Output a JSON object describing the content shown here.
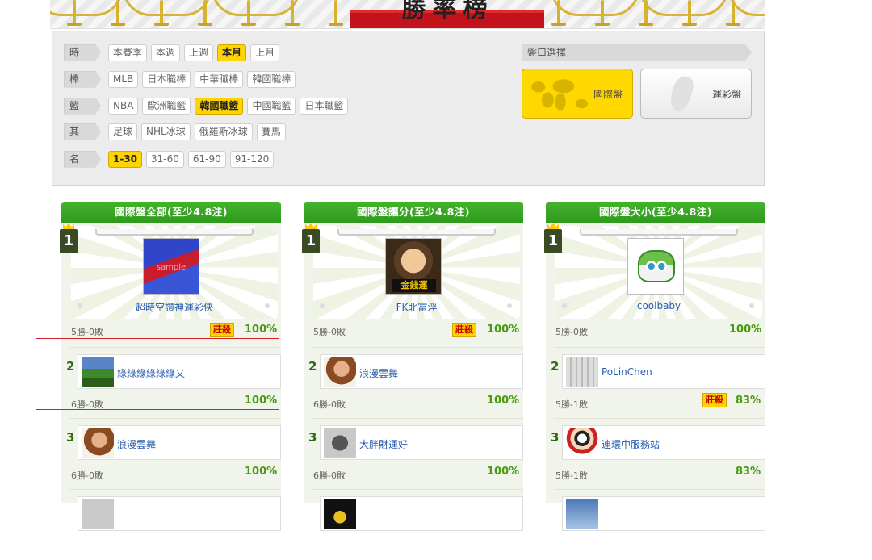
{
  "banner": {
    "title": "勝率榜"
  },
  "filters": [
    {
      "label": "時間",
      "options": [
        "本賽季",
        "本週",
        "上週",
        "本月",
        "上月"
      ],
      "active": 3
    },
    {
      "label": "棒球",
      "options": [
        "MLB",
        "日本職棒",
        "中華職棒",
        "韓國職棒"
      ],
      "active": -1
    },
    {
      "label": "籃球",
      "options": [
        "NBA",
        "歐洲職籃",
        "韓國職籃",
        "中國職籃",
        "日本職籃"
      ],
      "active": 2
    },
    {
      "label": "其他",
      "options": [
        "足球",
        "NHL冰球",
        "俄羅斯冰球",
        "賽馬"
      ],
      "active": -1
    },
    {
      "label": "名次",
      "options": [
        "1-30",
        "31-60",
        "61-90",
        "91-120"
      ],
      "active": 0
    }
  ],
  "pankou": {
    "label": "盤口選擇",
    "intl": "國際盤",
    "tw": "運彩盤"
  },
  "panels": [
    {
      "title": "國際盤全部(至少4.8注)",
      "top": {
        "name": "超時空讚神運彩俠",
        "record": "5勝-0敗",
        "tag": "莊殺",
        "pct": "100%",
        "avatar_text": "sample"
      },
      "rows": [
        {
          "rank": "2",
          "name": "綠綠綠綠綠綠乂",
          "record": "6勝-0敗",
          "pct": "100%",
          "tag": ""
        },
        {
          "rank": "3",
          "name": "浪漫雲舞",
          "record": "6勝-0敗",
          "pct": "100%",
          "tag": ""
        }
      ]
    },
    {
      "title": "國際盤讓分(至少4.8注)",
      "top": {
        "name": "FK北富淫",
        "record": "5勝-0敗",
        "tag": "莊殺",
        "pct": "100%",
        "avatar_text": "金錢運"
      },
      "rows": [
        {
          "rank": "2",
          "name": "浪漫雲舞",
          "record": "6勝-0敗",
          "pct": "100%",
          "tag": ""
        },
        {
          "rank": "3",
          "name": "大胖財運好",
          "record": "6勝-0敗",
          "pct": "100%",
          "tag": ""
        }
      ]
    },
    {
      "title": "國際盤大小(至少4.8注)",
      "top": {
        "name": "coolbaby",
        "record": "5勝-0敗",
        "tag": "",
        "pct": "100%",
        "avatar_text": ""
      },
      "rows": [
        {
          "rank": "2",
          "name": "PoLinChen",
          "record": "5勝-1敗",
          "pct": "83%",
          "tag": "莊殺"
        },
        {
          "rank": "3",
          "name": "連環中服務站",
          "record": "5勝-1敗",
          "pct": "83%",
          "tag": ""
        }
      ]
    }
  ]
}
